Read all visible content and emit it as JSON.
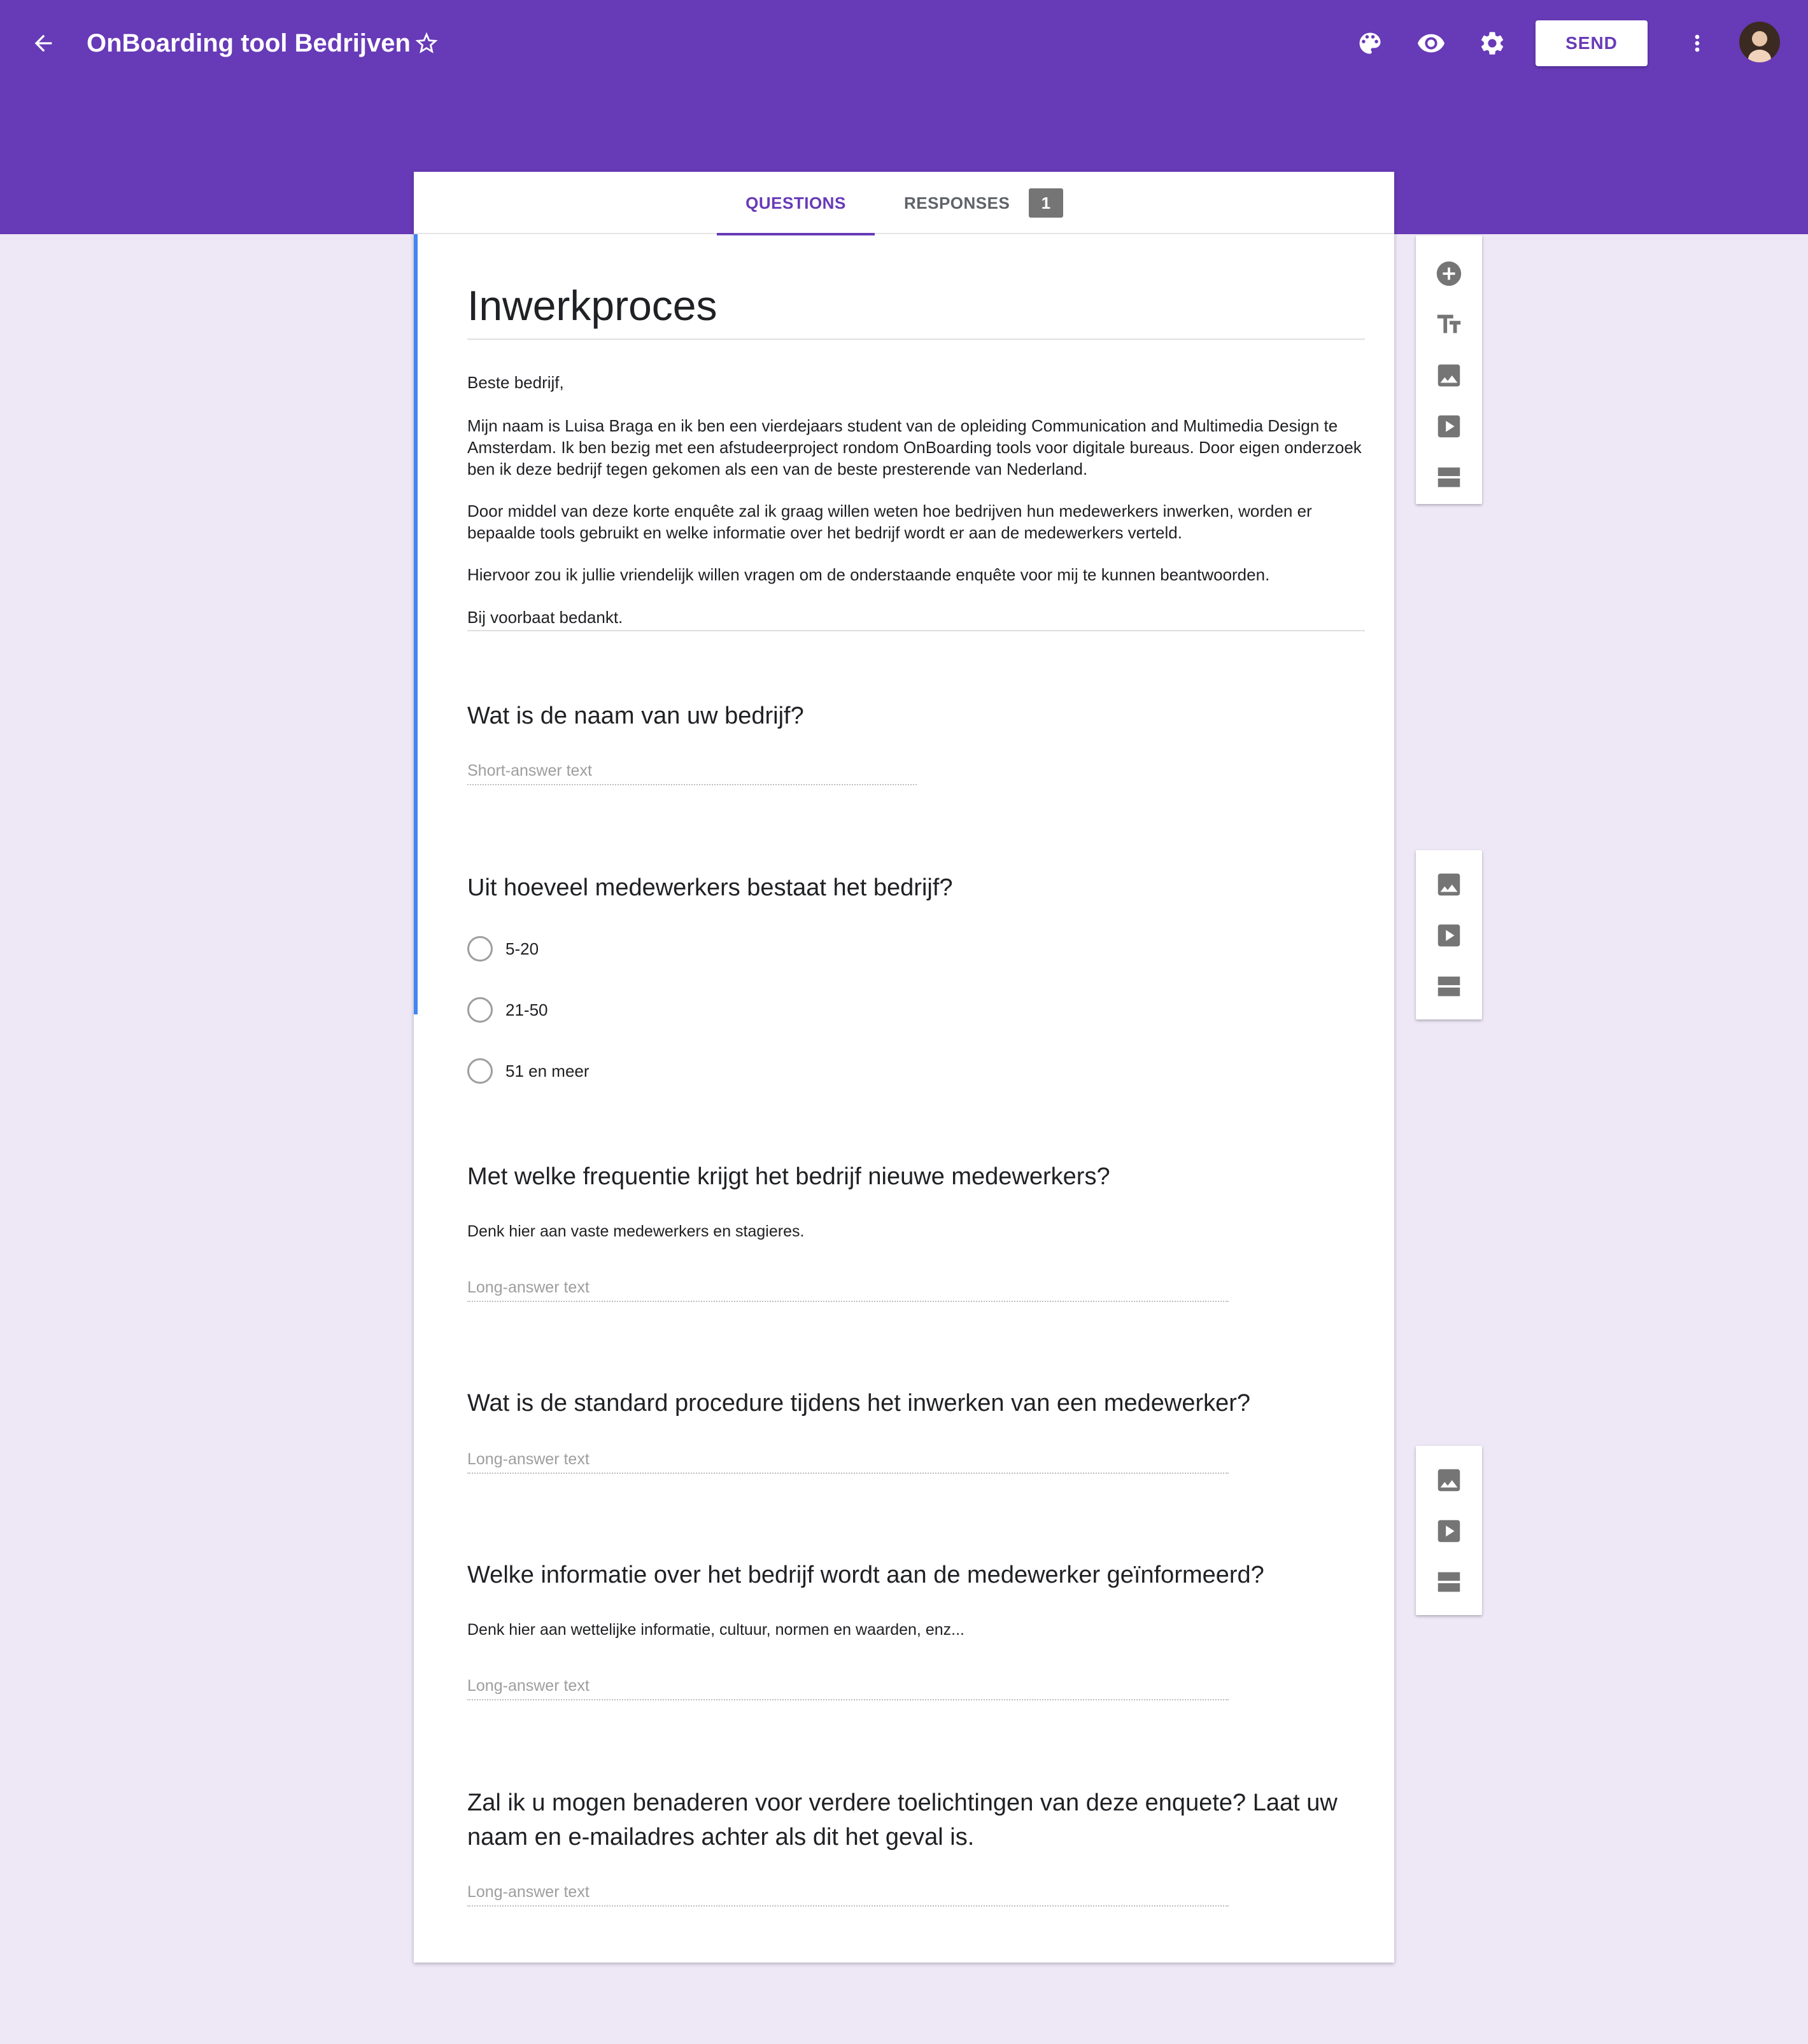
{
  "header": {
    "back_icon": "arrow-back-icon",
    "title": "OnBoarding tool Bedrijven",
    "star_icon": "star-outline-icon",
    "palette_icon": "palette-icon",
    "preview_icon": "eye-icon",
    "settings_icon": "gear-icon",
    "send_label": "SEND",
    "more_icon": "more-vertical-icon",
    "avatar_icon": "user-avatar"
  },
  "colors": {
    "brand": "#673ab7",
    "background": "#ede7f6",
    "active_accent": "#4285f4",
    "badge": "#757575"
  },
  "tabs": {
    "questions_label": "QUESTIONS",
    "responses_label": "RESPONSES",
    "responses_count": "1"
  },
  "form": {
    "title": "Inwerkproces",
    "description": [
      "Beste bedrijf,",
      "Mijn naam is Luisa Braga en ik ben een vierdejaars student van de opleiding Communication and Multimedia Design te Amsterdam. Ik ben bezig met een afstudeerproject rondom OnBoarding tools voor digitale bureaus. Door eigen onderzoek ben ik deze bedrijf tegen gekomen als een van de beste presterende van Nederland.",
      "Door middel van deze korte enquête zal ik graag willen weten hoe bedrijven hun medewerkers inwerken, worden er bepaalde tools gebruikt en welke informatie over het bedrijf wordt er aan de medewerkers verteld.",
      "Hiervoor zou ik jullie vriendelijk willen vragen om de onderstaande enquête voor mij te kunnen beantwoorden.",
      "Bij voorbaat bedankt."
    ]
  },
  "questions": [
    {
      "title": "Wat is de naam van uw bedrijf?",
      "answer_placeholder": "Short-answer text"
    },
    {
      "title": "Uit hoeveel medewerkers bestaat het bedrijf?",
      "options": [
        "5-20",
        "21-50",
        "51 en meer"
      ]
    },
    {
      "title": "Met welke frequentie krijgt het bedrijf nieuwe medewerkers?",
      "help": "Denk hier aan vaste medewerkers en stagieres.",
      "answer_placeholder": "Long-answer text"
    },
    {
      "title": "Wat is de standard procedure tijdens het inwerken van een medewerker?",
      "answer_placeholder": "Long-answer text"
    },
    {
      "title": "Welke informatie over het bedrijf wordt aan de medewerker geïnformeerd?",
      "help": "Denk hier aan wettelijke informatie, cultuur, normen en waarden, enz...",
      "answer_placeholder": "Long-answer text"
    },
    {
      "title": "Zal ik u mogen benaderen voor verdere toelichtingen van deze enquete? Laat uw naam en e-mailadres achter als dit het geval is.",
      "answer_placeholder": "Long-answer text"
    }
  ],
  "side_toolbars": [
    [
      "add-question-icon",
      "title-text-icon",
      "image-icon",
      "video-icon",
      "section-icon"
    ],
    [
      "image-icon",
      "video-icon",
      "section-icon"
    ],
    [
      "image-icon",
      "video-icon",
      "section-icon"
    ]
  ]
}
